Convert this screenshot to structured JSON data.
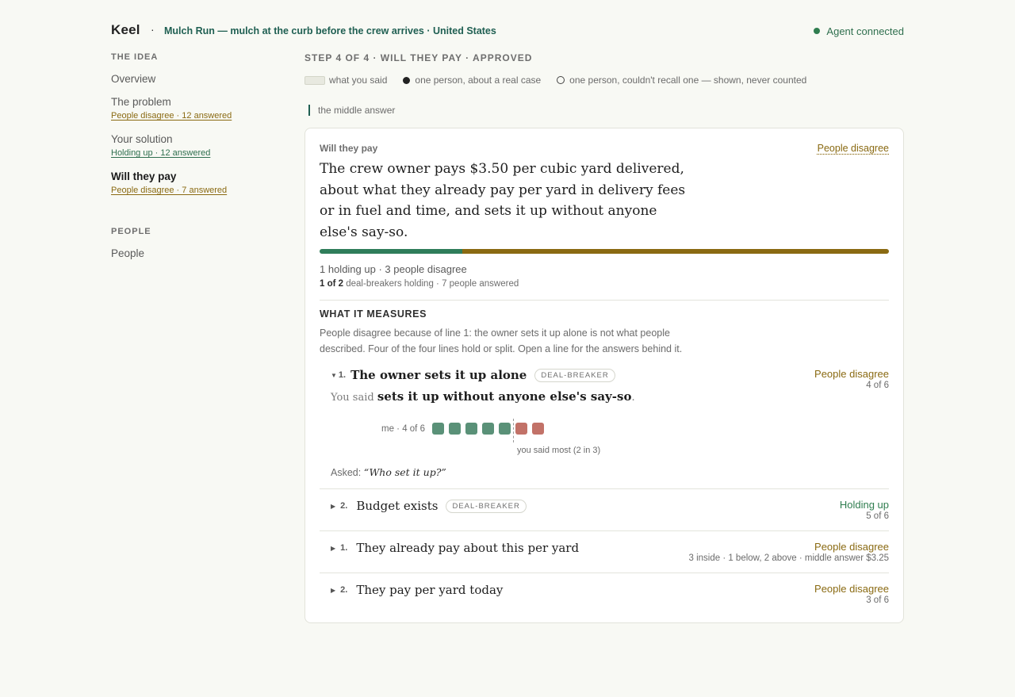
{
  "header": {
    "brand": "Keel",
    "separator": "·",
    "project": "Mulch Run — mulch at the curb before the crew arrives · United States",
    "agent_status": "Agent connected"
  },
  "sidebar": {
    "idea_heading": "THE IDEA",
    "items": [
      {
        "label": "Overview",
        "sub": ""
      },
      {
        "label": "The problem",
        "sub": "People disagree · 12 answered"
      },
      {
        "label": "Your solution",
        "sub": "Holding up · 12 answered"
      },
      {
        "label": "Will they pay",
        "sub": "People disagree · 7 answered"
      }
    ],
    "people_heading": "PEOPLE",
    "people_item": "People"
  },
  "main": {
    "step": "STEP 4 OF 4 · WILL THEY PAY · APPROVED",
    "legend": {
      "said": "what you said",
      "real_case": "one person, about a real case",
      "no_recall": "one person, couldn't recall one — shown, never counted"
    },
    "middle_answer": "the middle answer",
    "card": {
      "kicker": "Will they pay",
      "status": "People disagree",
      "claim": "The crew owner pays $3.50 per cubic yard delivered, about what they already pay per yard in delivery fees or in fuel and time, and sets it up without anyone else's say-so.",
      "bar": {
        "holding_fraction": 0.25,
        "disagree_fraction": 0.75
      },
      "counts": "1 holding up · 3 people disagree",
      "deal_bold": "1 of 2",
      "deal_rest": "deal-breakers holding · 7 people answered",
      "measures_heading": "WHAT IT MEASURES",
      "measures_text": "People disagree because of line 1: the owner sets it up alone is not what people described. Four of the four lines hold or split. Open a line for the answers behind it.",
      "open_line": {
        "num": "1.",
        "title": "The owner sets it up alone",
        "tag": "DEAL-BREAKER",
        "status": "People disagree",
        "count": "4 of 6",
        "you_said_prefix": "You said",
        "you_said_quote": "sets it up without anyone else's say-so",
        "you_said_suffix": ".",
        "dots_label": "me · 4 of 6",
        "dots": [
          "agree",
          "agree",
          "agree",
          "agree",
          "agree",
          "disagree",
          "disagree"
        ],
        "cut_label": "you said most (2 in 3)",
        "asked_prefix": "Asked:",
        "asked_question": "“Who set it up?”"
      },
      "rows": [
        {
          "num": "2.",
          "title": "Budget exists",
          "tag": "DEAL-BREAKER",
          "status": "Holding up",
          "count": "5 of 6"
        },
        {
          "num": "1.",
          "title": "They already pay about this per yard",
          "tag": "",
          "status": "People disagree",
          "count": "3 inside · 1 below, 2 above · middle answer $3.25"
        },
        {
          "num": "2.",
          "title": "They pay per yard today",
          "tag": "",
          "status": "People disagree",
          "count": "3 of 6"
        }
      ]
    }
  },
  "colors": {
    "holding": "#2f7d5a",
    "disagree": "#8a6a12",
    "dot_agree": "#5a9178",
    "dot_disagree": "#c27268",
    "accent": "#1f5f52"
  }
}
